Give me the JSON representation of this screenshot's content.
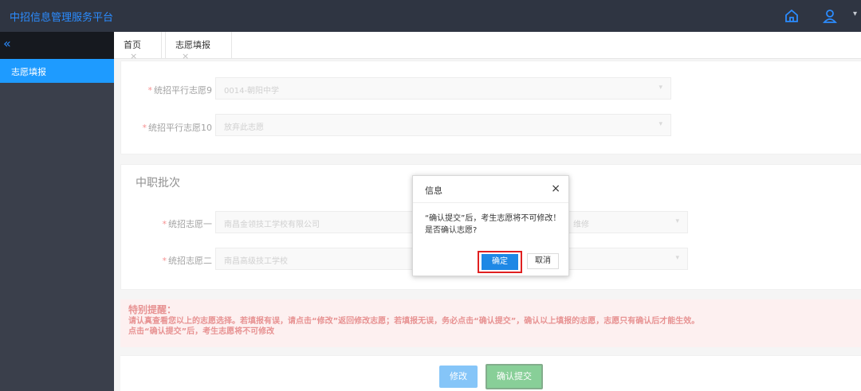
{
  "app": {
    "title": "中招信息管理服务平台"
  },
  "header": {
    "home_icon": "home-icon",
    "user_icon": "user-icon",
    "caret": "▾"
  },
  "sidebar": {
    "collapse": "«",
    "items": [
      {
        "label": "志愿填报"
      }
    ]
  },
  "tabs": [
    {
      "label": "首页",
      "close": "×"
    },
    {
      "label": "志愿填报",
      "close": "×"
    }
  ],
  "form": {
    "batch1": {
      "fields": [
        {
          "required": "*",
          "label": "统招平行志愿9",
          "value": "0014-朝阳中学"
        },
        {
          "required": "*",
          "label": "统招平行志愿10",
          "value": "放弃此志愿"
        }
      ]
    },
    "batch2": {
      "title": "中职批次",
      "fields": [
        {
          "required": "*",
          "label": "统招志愿一",
          "value": "南昌金领技工学校有限公司",
          "value2": "维修"
        },
        {
          "required": "*",
          "label": "统招志愿二",
          "value": "南昌高级技工学校",
          "value2": ""
        }
      ]
    }
  },
  "notice": {
    "title": "特别提醒：",
    "line1": "请认真查看您以上的志愿选择。若填报有误，请点击“修改”返回修改志愿；若填报无误，务必点击“确认提交”，确认以上填报的志愿，志愿只有确认后才能生效。",
    "line2": "点击“确认提交”后，考生志愿将不可修改"
  },
  "actions": {
    "modify": "修改",
    "submit": "确认提交"
  },
  "dialog": {
    "title": "信息",
    "close": "×",
    "message_line1": "“确认提交”后，考生志愿将不可修改！",
    "message_line2": "是否确认志愿?",
    "ok": "确定",
    "cancel": "取消"
  },
  "colors": {
    "topbar": "#2f3542",
    "accent": "#1e9bff",
    "notice_text": "#d43a3a",
    "submit": "#27a844",
    "highlight": "#e02020"
  }
}
